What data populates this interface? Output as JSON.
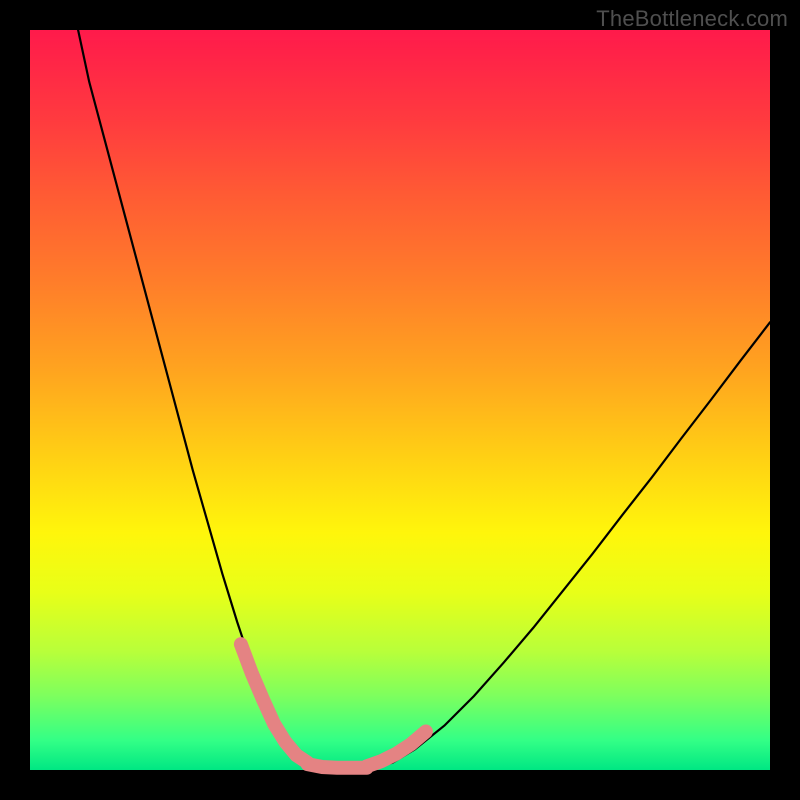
{
  "watermark": "TheBottleneck.com",
  "chart_data": {
    "type": "line",
    "title": "",
    "xlabel": "",
    "ylabel": "",
    "xlim": [
      0,
      1
    ],
    "ylim": [
      0,
      1
    ],
    "legend": false,
    "grid": false,
    "background_gradient": [
      "#ff1a4b",
      "#ff7d2a",
      "#fff60b",
      "#00e783"
    ],
    "series": [
      {
        "name": "curve",
        "color": "#000000",
        "x": [
          0.065,
          0.08,
          0.1,
          0.12,
          0.14,
          0.16,
          0.18,
          0.2,
          0.22,
          0.24,
          0.26,
          0.28,
          0.3,
          0.315,
          0.33,
          0.345,
          0.36,
          0.375,
          0.395,
          0.42,
          0.44,
          0.45,
          0.465,
          0.49,
          0.52,
          0.56,
          0.6,
          0.64,
          0.68,
          0.72,
          0.76,
          0.8,
          0.84,
          0.88,
          0.92,
          0.96,
          1.0
        ],
        "y": [
          1.0,
          0.93,
          0.855,
          0.78,
          0.705,
          0.63,
          0.555,
          0.48,
          0.405,
          0.335,
          0.265,
          0.2,
          0.14,
          0.102,
          0.07,
          0.045,
          0.028,
          0.016,
          0.007,
          0.003,
          0.002,
          0.002,
          0.003,
          0.01,
          0.028,
          0.06,
          0.1,
          0.145,
          0.192,
          0.242,
          0.292,
          0.344,
          0.395,
          0.448,
          0.5,
          0.553,
          0.605
        ]
      },
      {
        "name": "highlight-left",
        "color": "#e48383",
        "x": [
          0.285,
          0.3,
          0.315,
          0.33,
          0.345,
          0.36,
          0.375
        ],
        "y": [
          0.17,
          0.13,
          0.095,
          0.062,
          0.038,
          0.02,
          0.01
        ]
      },
      {
        "name": "highlight-bottom",
        "color": "#e48383",
        "x": [
          0.375,
          0.395,
          0.415,
          0.435,
          0.455
        ],
        "y": [
          0.008,
          0.004,
          0.003,
          0.003,
          0.003
        ]
      },
      {
        "name": "highlight-right",
        "color": "#e48383",
        "x": [
          0.455,
          0.475,
          0.495,
          0.515,
          0.535
        ],
        "y": [
          0.005,
          0.012,
          0.022,
          0.035,
          0.052
        ]
      }
    ]
  }
}
